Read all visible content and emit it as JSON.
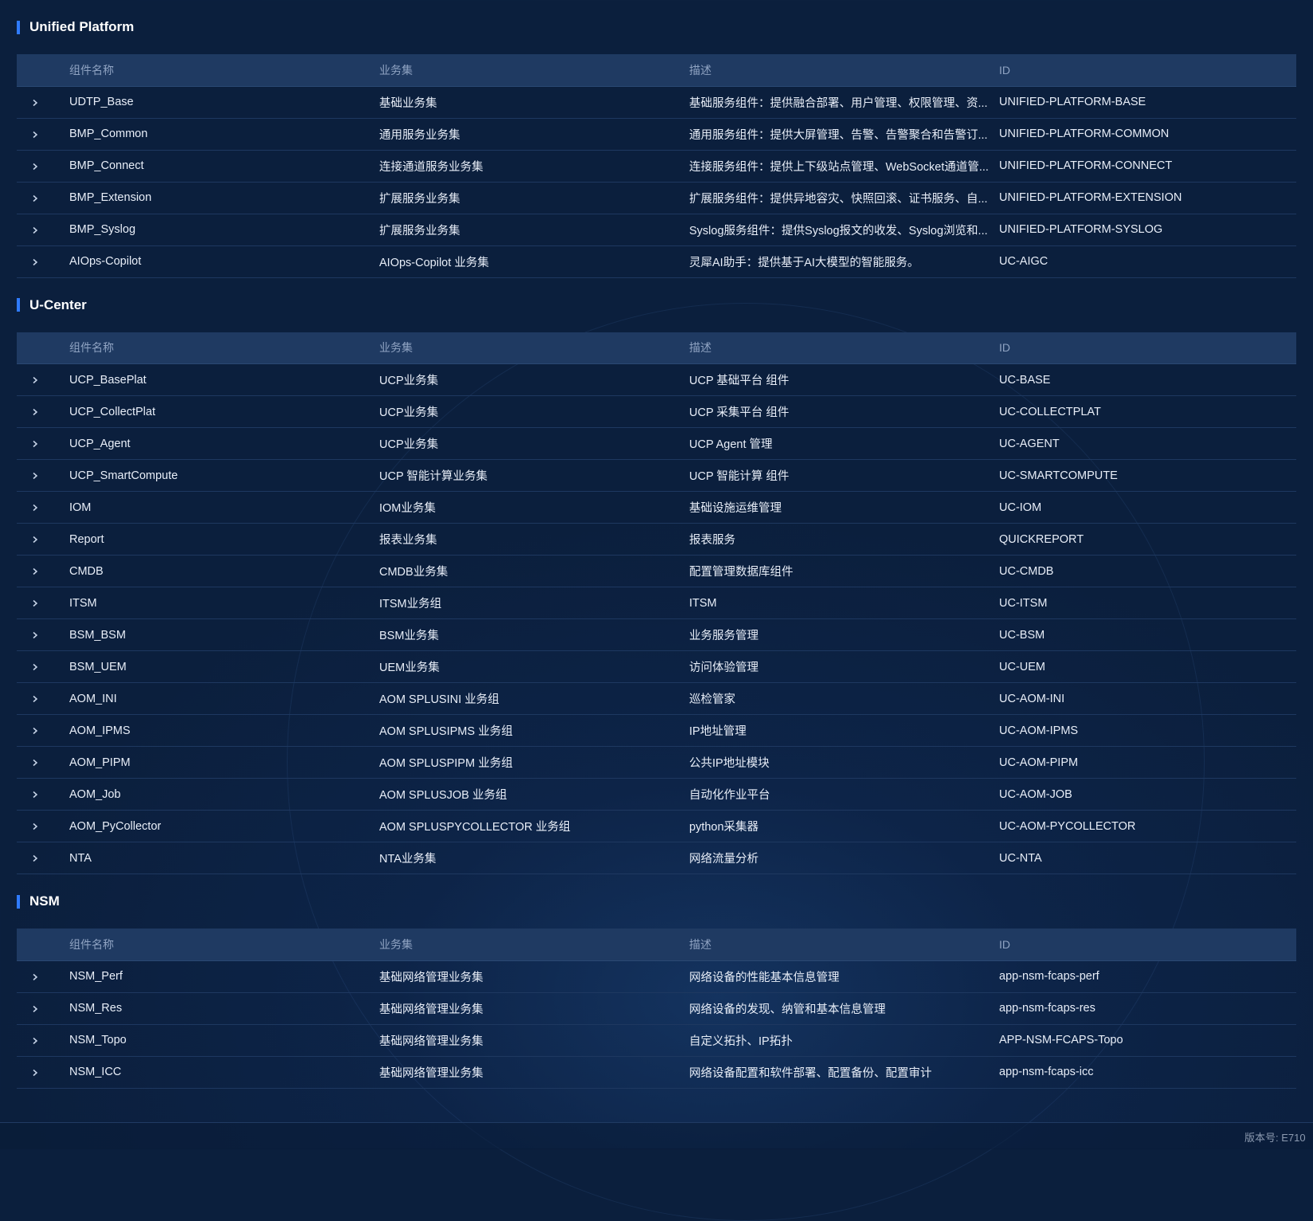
{
  "columns": {
    "name": "组件名称",
    "bizset": "业务集",
    "desc": "描述",
    "id": "ID"
  },
  "sections": [
    {
      "title": "Unified Platform",
      "rows": [
        {
          "name": "UDTP_Base",
          "bizset": "基础业务集",
          "desc": "基础服务组件：提供融合部署、用户管理、权限管理、资...",
          "id": "UNIFIED-PLATFORM-BASE"
        },
        {
          "name": "BMP_Common",
          "bizset": "通用服务业务集",
          "desc": "通用服务组件：提供大屏管理、告警、告警聚合和告警订...",
          "id": "UNIFIED-PLATFORM-COMMON"
        },
        {
          "name": "BMP_Connect",
          "bizset": "连接通道服务业务集",
          "desc": "连接服务组件：提供上下级站点管理、WebSocket通道管...",
          "id": "UNIFIED-PLATFORM-CONNECT"
        },
        {
          "name": "BMP_Extension",
          "bizset": "扩展服务业务集",
          "desc": "扩展服务组件：提供异地容灾、快照回滚、证书服务、自...",
          "id": "UNIFIED-PLATFORM-EXTENSION"
        },
        {
          "name": "BMP_Syslog",
          "bizset": "扩展服务业务集",
          "desc": "Syslog服务组件：提供Syslog报文的收发、Syslog浏览和...",
          "id": "UNIFIED-PLATFORM-SYSLOG"
        },
        {
          "name": "AIOps-Copilot",
          "bizset": "AIOps-Copilot 业务集",
          "desc": "灵犀AI助手：提供基于AI大模型的智能服务。",
          "id": "UC-AIGC"
        }
      ]
    },
    {
      "title": "U-Center",
      "rows": [
        {
          "name": "UCP_BasePlat",
          "bizset": "UCP业务集",
          "desc": "UCP 基础平台 组件",
          "id": "UC-BASE"
        },
        {
          "name": "UCP_CollectPlat",
          "bizset": "UCP业务集",
          "desc": "UCP 采集平台 组件",
          "id": "UC-COLLECTPLAT"
        },
        {
          "name": "UCP_Agent",
          "bizset": "UCP业务集",
          "desc": "UCP Agent 管理",
          "id": "UC-AGENT"
        },
        {
          "name": "UCP_SmartCompute",
          "bizset": "UCP 智能计算业务集",
          "desc": "UCP 智能计算 组件",
          "id": "UC-SMARTCOMPUTE"
        },
        {
          "name": "IOM",
          "bizset": "IOM业务集",
          "desc": "基础设施运维管理",
          "id": "UC-IOM"
        },
        {
          "name": "Report",
          "bizset": "报表业务集",
          "desc": "报表服务",
          "id": "QUICKREPORT"
        },
        {
          "name": "CMDB",
          "bizset": "CMDB业务集",
          "desc": "配置管理数据库组件",
          "id": "UC-CMDB"
        },
        {
          "name": "ITSM",
          "bizset": "ITSM业务组",
          "desc": "ITSM",
          "id": "UC-ITSM"
        },
        {
          "name": "BSM_BSM",
          "bizset": "BSM业务集",
          "desc": "业务服务管理",
          "id": "UC-BSM"
        },
        {
          "name": "BSM_UEM",
          "bizset": "UEM业务集",
          "desc": "访问体验管理",
          "id": "UC-UEM"
        },
        {
          "name": "AOM_INI",
          "bizset": "AOM SPLUSINI 业务组",
          "desc": "巡检管家",
          "id": "UC-AOM-INI"
        },
        {
          "name": "AOM_IPMS",
          "bizset": "AOM SPLUSIPMS 业务组",
          "desc": "IP地址管理",
          "id": "UC-AOM-IPMS"
        },
        {
          "name": "AOM_PIPM",
          "bizset": "AOM SPLUSPIPM 业务组",
          "desc": "公共IP地址模块",
          "id": "UC-AOM-PIPM"
        },
        {
          "name": "AOM_Job",
          "bizset": "AOM SPLUSJOB 业务组",
          "desc": "自动化作业平台",
          "id": "UC-AOM-JOB"
        },
        {
          "name": "AOM_PyCollector",
          "bizset": "AOM SPLUSPYCOLLECTOR 业务组",
          "desc": "python采集器",
          "id": "UC-AOM-PYCOLLECTOR"
        },
        {
          "name": "NTA",
          "bizset": "NTA业务集",
          "desc": "网络流量分析",
          "id": "UC-NTA"
        }
      ]
    },
    {
      "title": "NSM",
      "rows": [
        {
          "name": "NSM_Perf",
          "bizset": "基础网络管理业务集",
          "desc": "网络设备的性能基本信息管理",
          "id": "app-nsm-fcaps-perf"
        },
        {
          "name": "NSM_Res",
          "bizset": "基础网络管理业务集",
          "desc": "网络设备的发现、纳管和基本信息管理",
          "id": "app-nsm-fcaps-res"
        },
        {
          "name": "NSM_Topo",
          "bizset": "基础网络管理业务集",
          "desc": "自定义拓扑、IP拓扑",
          "id": "APP-NSM-FCAPS-Topo"
        },
        {
          "name": "NSM_ICC",
          "bizset": "基础网络管理业务集",
          "desc": "网络设备配置和软件部署、配置备份、配置审计",
          "id": "app-nsm-fcaps-icc"
        }
      ]
    }
  ],
  "footer": {
    "version": "版本号: E710"
  }
}
